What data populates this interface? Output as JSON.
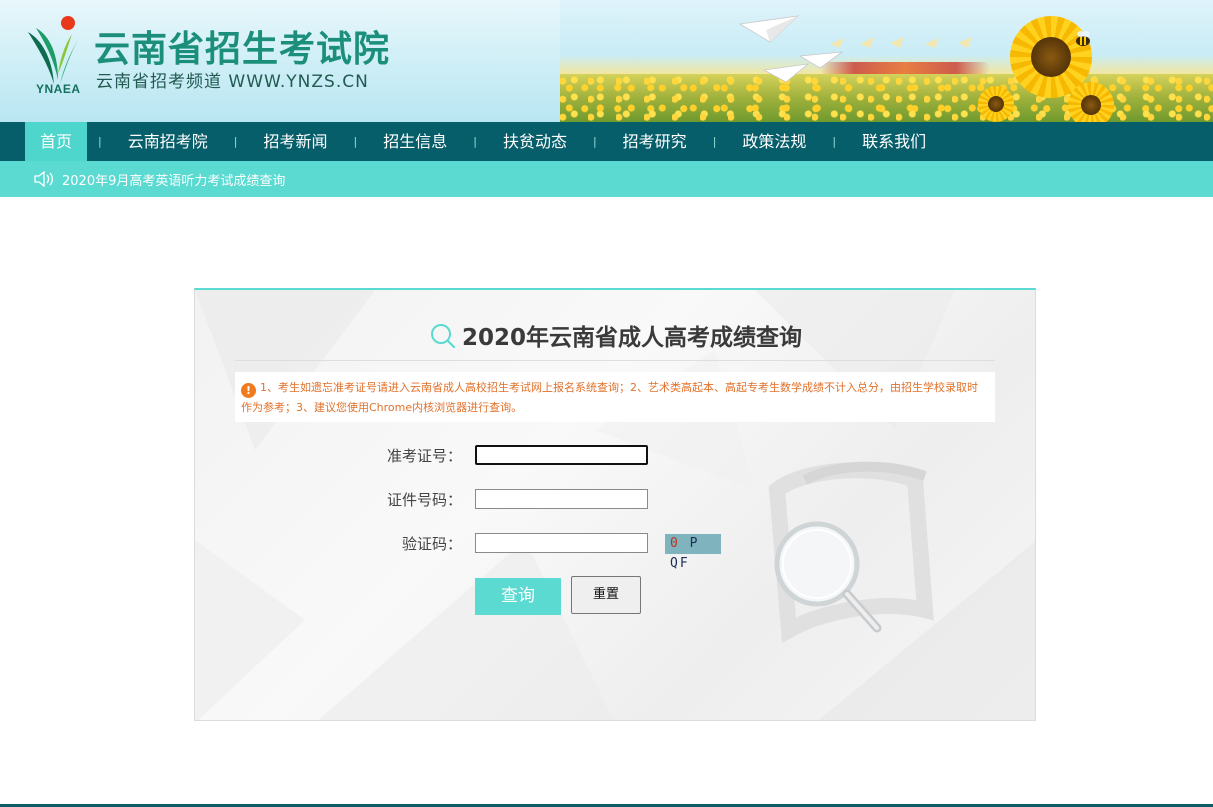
{
  "header": {
    "logo_text": "YNAEA",
    "site_title": "云南省招生考试院",
    "site_subtitle": "云南省招考频道  WWW.YNZS.CN"
  },
  "nav": {
    "items": [
      {
        "label": "首页",
        "active": true
      },
      {
        "label": "云南招考院"
      },
      {
        "label": "招考新闻"
      },
      {
        "label": "招生信息"
      },
      {
        "label": "扶贫动态"
      },
      {
        "label": "招考研究"
      },
      {
        "label": "政策法规"
      },
      {
        "label": "联系我们"
      }
    ],
    "separator": "|"
  },
  "notice": {
    "icon": "speaker-icon",
    "text": "2020年9月高考英语听力考试成绩查询"
  },
  "query": {
    "title": "2020年云南省成人高考成绩查询",
    "tip_icon": "warning-icon",
    "tip": "1、考生如遗忘准考证号请进入云南省成人高校招生考试网上报名系统查询；2、艺术类高起本、高起专考生数学成绩不计入总分，由招生学校录取时作为参考；3、建议您使用Chrome内核浏览器进行查询。",
    "fields": {
      "exam_no": {
        "label": "准考证号：",
        "value": ""
      },
      "id_no": {
        "label": "证件号码：",
        "value": ""
      },
      "captcha": {
        "label": "验证码：",
        "value": ""
      }
    },
    "captcha_first": "0",
    "captcha_rest": " P QF",
    "submit_label": "查询",
    "reset_label": "重置"
  },
  "colors": {
    "nav_bg": "#075e6b",
    "accent": "#5adad0",
    "tip_text": "#e0712a",
    "title_green": "#1b8f7b"
  }
}
